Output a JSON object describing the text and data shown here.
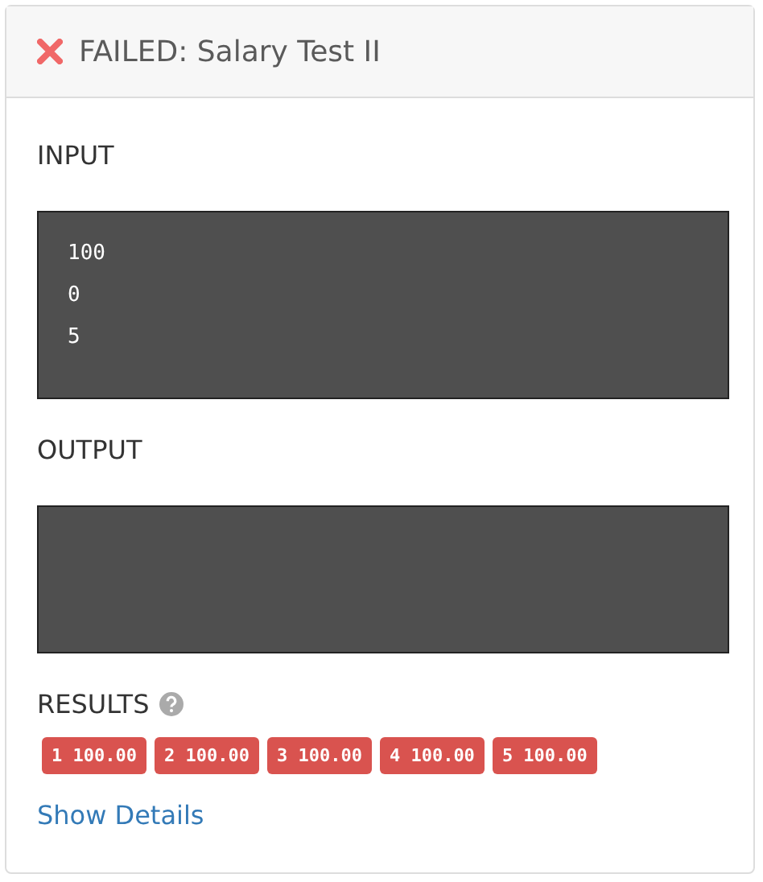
{
  "header": {
    "failed": true,
    "title": "FAILED: Salary Test II"
  },
  "input": {
    "label": "INPUT",
    "lines": [
      "100",
      "0",
      "5"
    ]
  },
  "output": {
    "label": "OUTPUT"
  },
  "results": {
    "label": "RESULTS",
    "items": [
      {
        "text": "1 100.00",
        "passed": false
      },
      {
        "text": "2 100.00",
        "passed": false
      },
      {
        "text": "3 100.00",
        "passed": false
      },
      {
        "text": "4 100.00",
        "passed": false
      },
      {
        "text": "5 100.00",
        "passed": false
      }
    ]
  },
  "link": "Show Details"
}
